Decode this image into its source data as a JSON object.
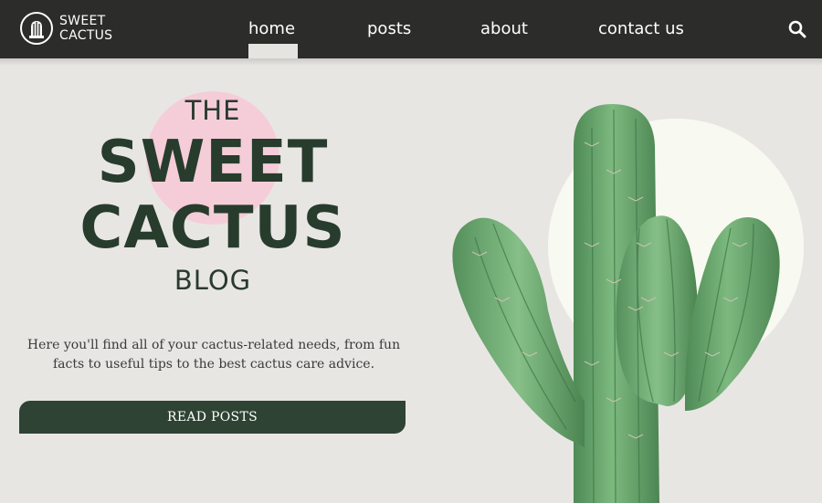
{
  "brand": {
    "line1": "SWEET",
    "line2": "CACTUS"
  },
  "nav": {
    "items": [
      {
        "label": "home",
        "active": true
      },
      {
        "label": "posts",
        "active": false
      },
      {
        "label": "about",
        "active": false
      },
      {
        "label": "contact us",
        "active": false
      }
    ],
    "search_icon": "search-icon"
  },
  "hero": {
    "title_top": "THE",
    "title_line1": "SWEET",
    "title_line2": "CACTUS",
    "title_bottom": "BLOG",
    "description": "Here you'll find all of your cactus-related needs, from fun facts to useful tips to the best cactus care advice.",
    "cta_label": "READ POSTS",
    "image": "cactus-image"
  },
  "colors": {
    "header_bg": "#2c2c2b",
    "page_bg": "#e8e6e3",
    "title_green": "#273c2c",
    "button_green": "#2e4333",
    "pink_accent": "#f5cdd9",
    "cactus_green": "#6aa46e",
    "backdrop_circle": "#f8faf1"
  }
}
